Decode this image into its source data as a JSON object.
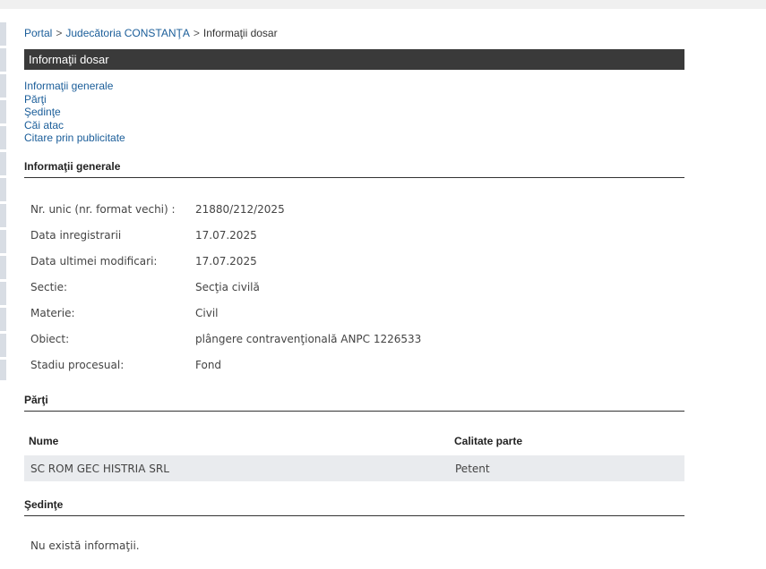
{
  "breadcrumb": {
    "items": [
      "Portal",
      "Judecătoria CONSTANŢA",
      "Informaţii dosar"
    ],
    "separator": ">"
  },
  "page_title": "Informaţii dosar",
  "anchor_links": [
    "Informaţii generale",
    "Părţi",
    "Şedinţe",
    "Căi atac",
    "Citare prin publicitate"
  ],
  "general_info": {
    "heading": "Informaţii generale",
    "rows": [
      {
        "label": "Nr. unic (nr. format vechi) :",
        "value": "21880/212/2025"
      },
      {
        "label": "Data inregistrarii",
        "value": "17.07.2025"
      },
      {
        "label": "Data ultimei modificari:",
        "value": "17.07.2025"
      },
      {
        "label": "Sectie:",
        "value": "Secţia civilă"
      },
      {
        "label": "Materie:",
        "value": "Civil"
      },
      {
        "label": "Obiect:",
        "value": "plângere contravenţională ANPC 1226533"
      },
      {
        "label": "Stadiu procesual:",
        "value": "Fond"
      }
    ]
  },
  "parties": {
    "heading": "Părţi",
    "columns": [
      "Nume",
      "Calitate parte"
    ],
    "rows": [
      {
        "name": "SC ROM GEC HISTRIA SRL",
        "role": "Petent"
      }
    ]
  },
  "hearings": {
    "heading": "Şedinţe",
    "empty_text": "Nu există informaţii."
  }
}
